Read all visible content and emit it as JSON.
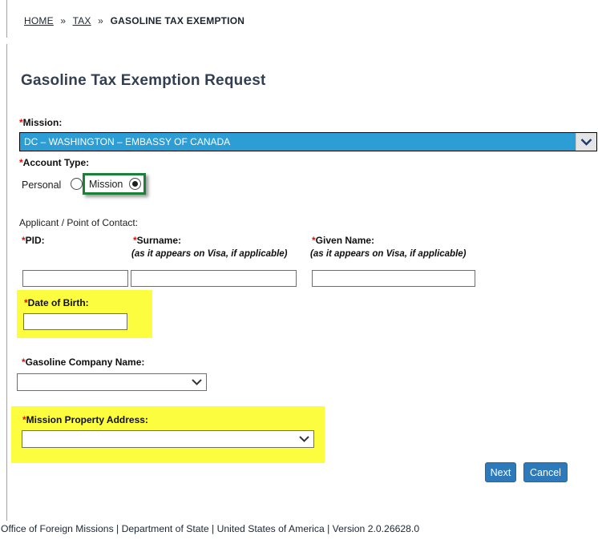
{
  "ui": {
    "required_marker": "*"
  },
  "breadcrumb": {
    "separator": "»",
    "items": [
      {
        "label": "HOME"
      },
      {
        "label": "TAX"
      },
      {
        "label": "GASOLINE TAX EXEMPTION"
      }
    ]
  },
  "page": {
    "title": "Gasoline Tax Exemption Request"
  },
  "form": {
    "mission": {
      "label": "Mission:",
      "selected_option": "DC – WASHINGTON – EMBASSY OF CANADA"
    },
    "account_type": {
      "label": "Account Type:",
      "options": [
        {
          "label": "Personal",
          "selected": false
        },
        {
          "label": "Mission",
          "selected": true
        }
      ]
    },
    "applicant_heading": "Applicant / Point of Contact:",
    "pid": {
      "label": "PID:",
      "value": ""
    },
    "surname": {
      "label": "Surname:",
      "hint": "(as it appears on Visa, if applicable)",
      "value": ""
    },
    "given_name": {
      "label": "Given Name:",
      "hint": "(as it appears on Visa, if applicable)",
      "value": ""
    },
    "date_of_birth": {
      "label": "Date of Birth:",
      "value": ""
    },
    "gasoline_company": {
      "label": "Gasoline Company Name:",
      "selected_option": ""
    },
    "mission_property_address": {
      "label": "Mission Property Address:",
      "selected_option": ""
    }
  },
  "buttons": {
    "next": "Next",
    "cancel": "Cancel"
  },
  "footer": {
    "text": "Office of Foreign Missions | Department of State | United States of America | Version 2.0.26628.0"
  },
  "icons": {
    "dropdown": "chevron-down-icon"
  },
  "colors": {
    "selected_option_blue": "#2D9DD6",
    "highlight_yellow": "#FDFD3F",
    "button_blue": "#2E79B9",
    "focus_outline_green": "#1C8038",
    "required_red": "#FF0000",
    "title_slate": "#333F50"
  }
}
